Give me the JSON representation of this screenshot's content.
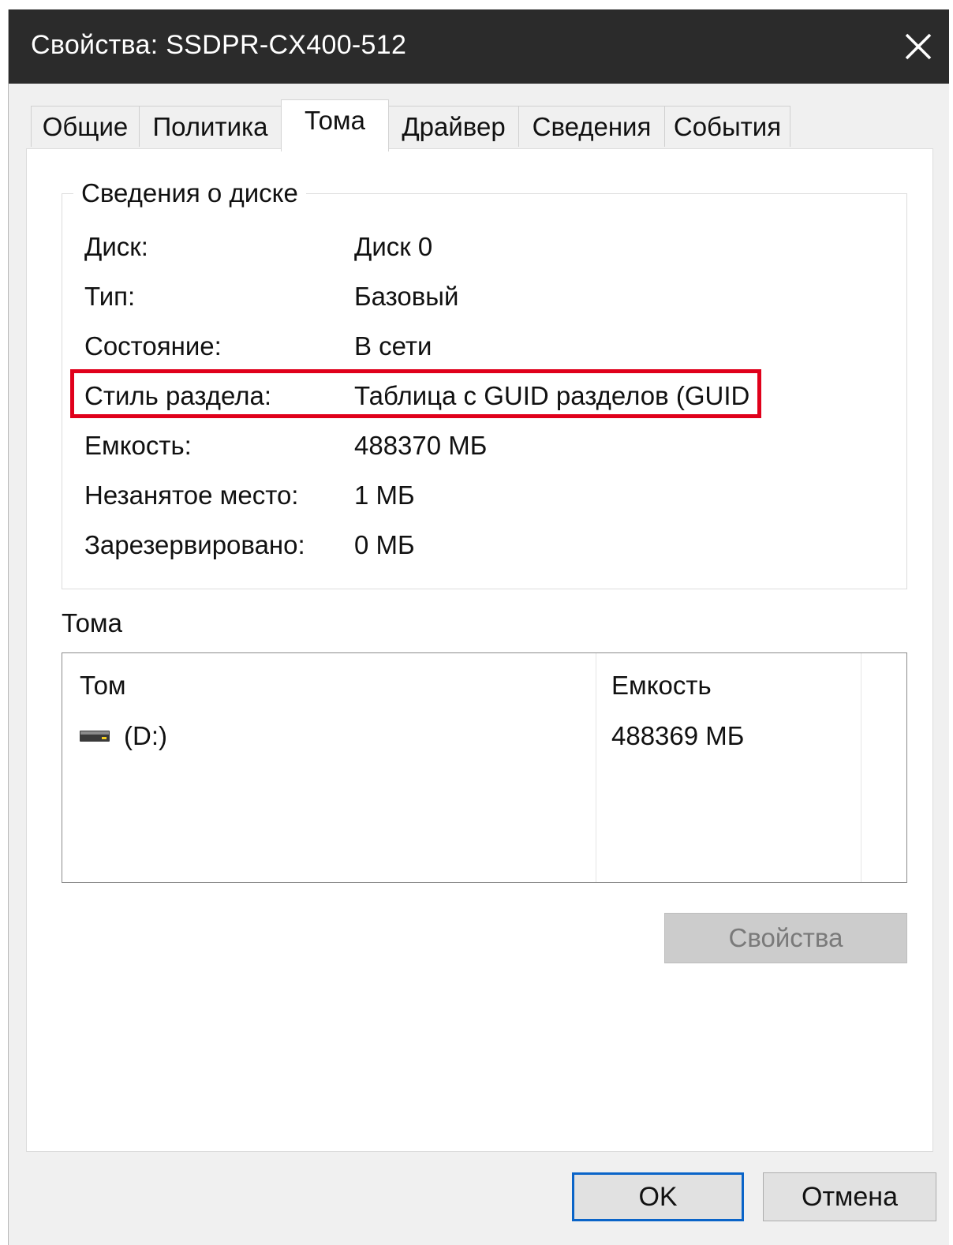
{
  "window": {
    "title": "Свойства: SSDPR-CX400-512",
    "close_icon": "close-icon"
  },
  "tabs": [
    {
      "label": "Общие",
      "active": false
    },
    {
      "label": "Политика",
      "active": false
    },
    {
      "label": "Тома",
      "active": true
    },
    {
      "label": "Драйвер",
      "active": false
    },
    {
      "label": "Сведения",
      "active": false
    },
    {
      "label": "События",
      "active": false
    }
  ],
  "disk_info": {
    "title": "Сведения о диске",
    "rows": [
      {
        "label": "Диск:",
        "value": "Диск 0"
      },
      {
        "label": "Тип:",
        "value": "Базовый"
      },
      {
        "label": "Состояние:",
        "value": "В сети"
      },
      {
        "label": "Стиль раздела:",
        "value": "Таблица с GUID разделов (GUID",
        "highlighted": true
      },
      {
        "label": "Емкость:",
        "value": "488370 МБ"
      },
      {
        "label": "Незанятое место:",
        "value": "1 МБ"
      },
      {
        "label": "Зарезервировано:",
        "value": "0 МБ"
      }
    ],
    "highlight_color": "#e0001b"
  },
  "volumes": {
    "title": "Тома",
    "columns": [
      "Том",
      "Емкость"
    ],
    "rows": [
      {
        "icon": "drive-icon",
        "volume": "(D:)",
        "capacity": "488369 МБ"
      }
    ]
  },
  "buttons": {
    "properties": "Свойства",
    "properties_enabled": false,
    "ok": "OK",
    "cancel": "Отмена"
  }
}
